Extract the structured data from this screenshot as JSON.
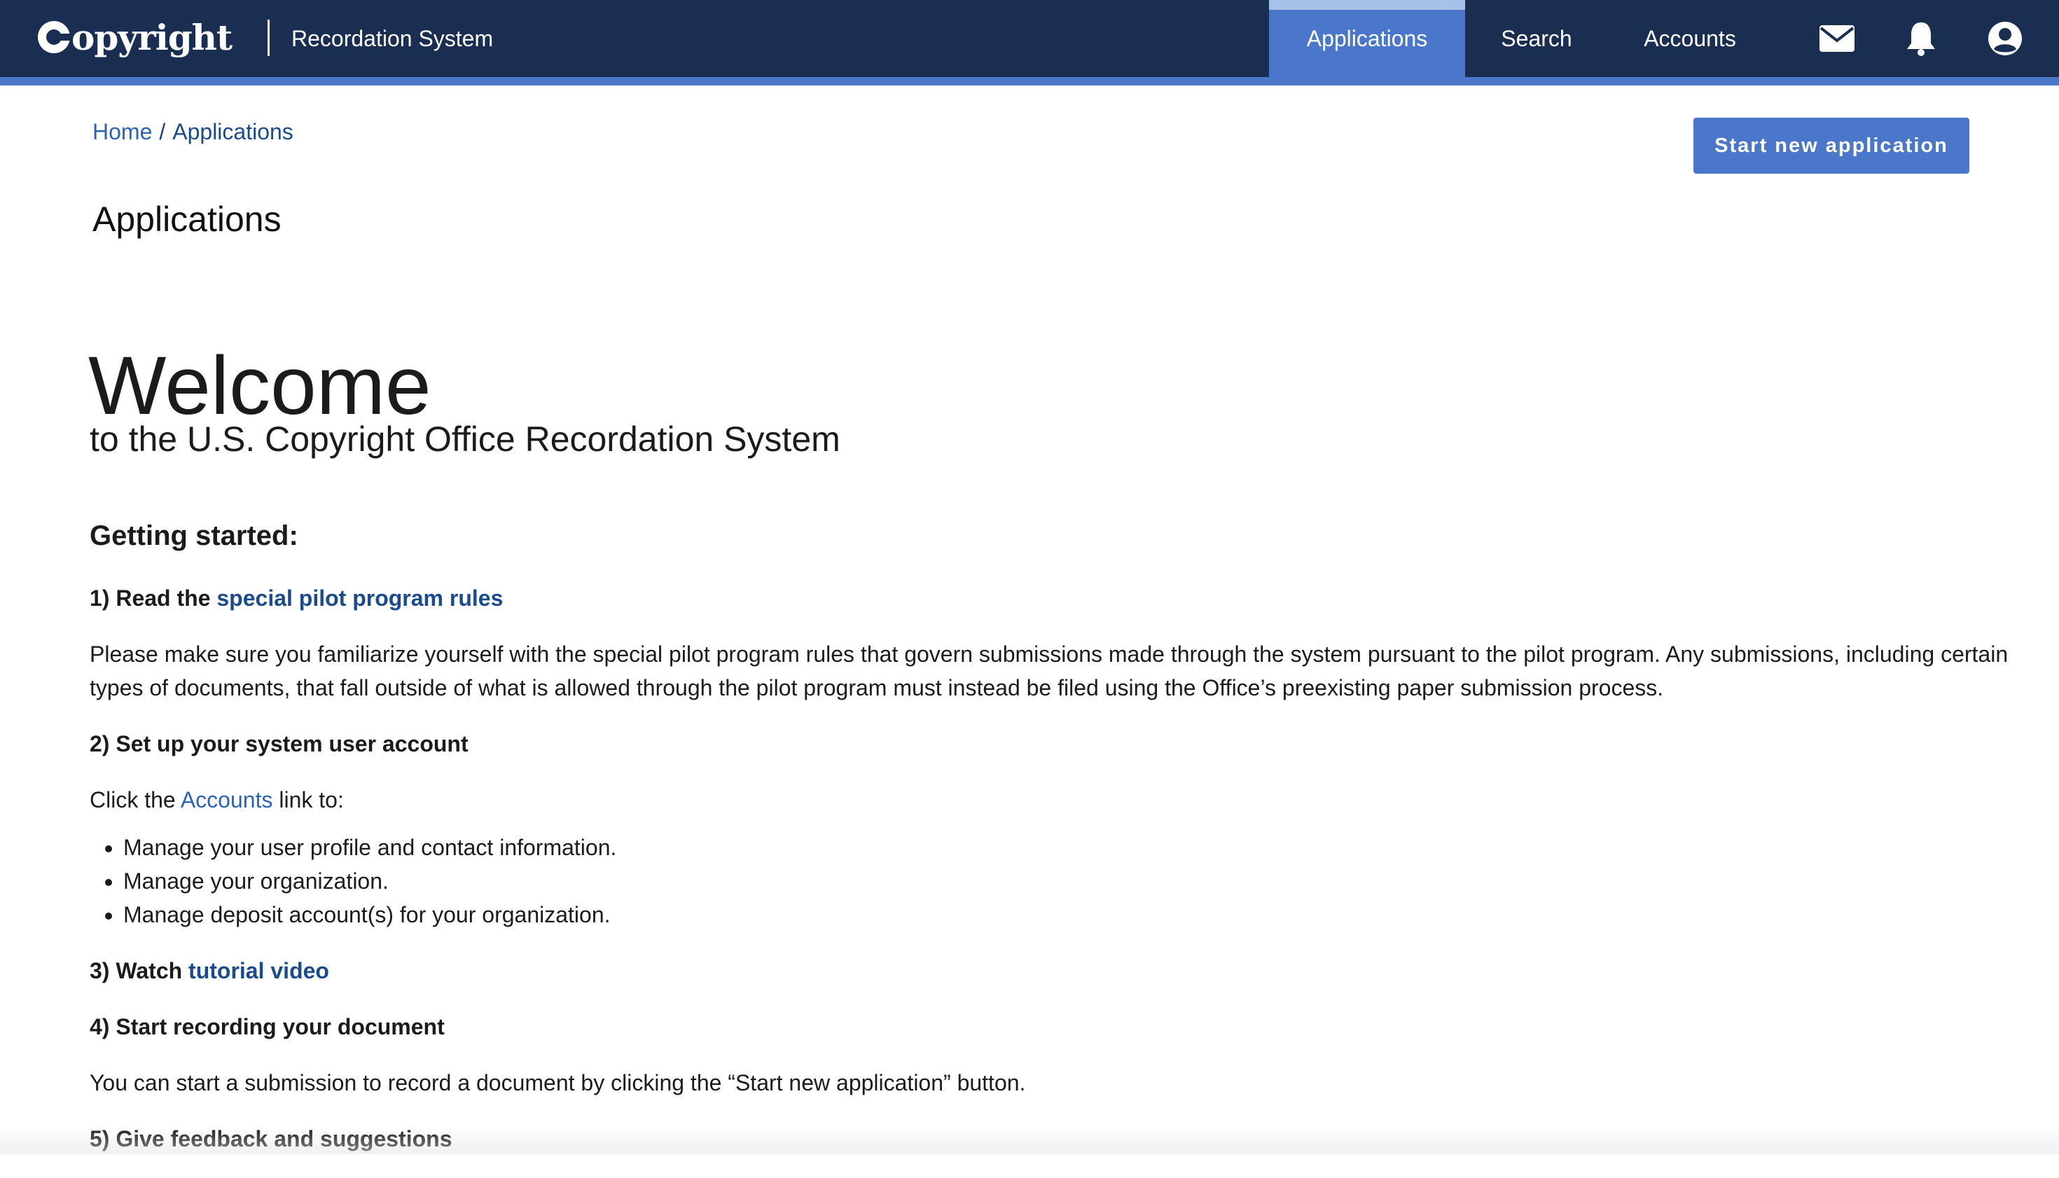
{
  "header": {
    "logo_text": "Copyright",
    "app_name": "Recordation System",
    "nav": {
      "applications": "Applications",
      "search": "Search",
      "accounts": "Accounts"
    },
    "icons": {
      "mail": "envelope-icon",
      "notifications": "bell-icon",
      "profile": "user-circle-icon"
    },
    "active_nav": "Applications"
  },
  "breadcrumb": {
    "home": "Home",
    "separator": "/",
    "current": "Applications"
  },
  "actions": {
    "start_new": "Start new application"
  },
  "page": {
    "title": "Applications",
    "welcome_title": "Welcome",
    "welcome_subtitle": "to the U.S. Copyright Office Recordation System"
  },
  "getting_started": {
    "heading": "Getting started:",
    "step1_prefix": "1) Read the",
    "step1_link": "special pilot program rules",
    "step1_body": "Please make sure you familiarize yourself with the special pilot program rules that govern submissions made through the system pursuant to the pilot program. Any submissions, including certain types of documents, that fall outside of what is allowed through the pilot program must instead be filed using the Office’s preexisting paper submission process.",
    "step2": "2) Set up your system user account",
    "step2_body_prefix": "Click the",
    "step2_body_link": "Accounts",
    "step2_body_suffix": "link to:",
    "step2_bullets": [
      "Manage your user profile and contact information.",
      "Manage your organization.",
      "Manage deposit account(s) for your organization."
    ],
    "step3_prefix": "3) Watch",
    "step3_link": "tutorial video",
    "step4": "4) Start recording your document",
    "step4_body": "You can start a submission to record a document by clicking the “Start new application” button.",
    "step5": "5) Give feedback and suggestions"
  },
  "colors": {
    "header_bg": "#1a2e52",
    "accent": "#4a77c9",
    "link": "#2a63ba"
  }
}
